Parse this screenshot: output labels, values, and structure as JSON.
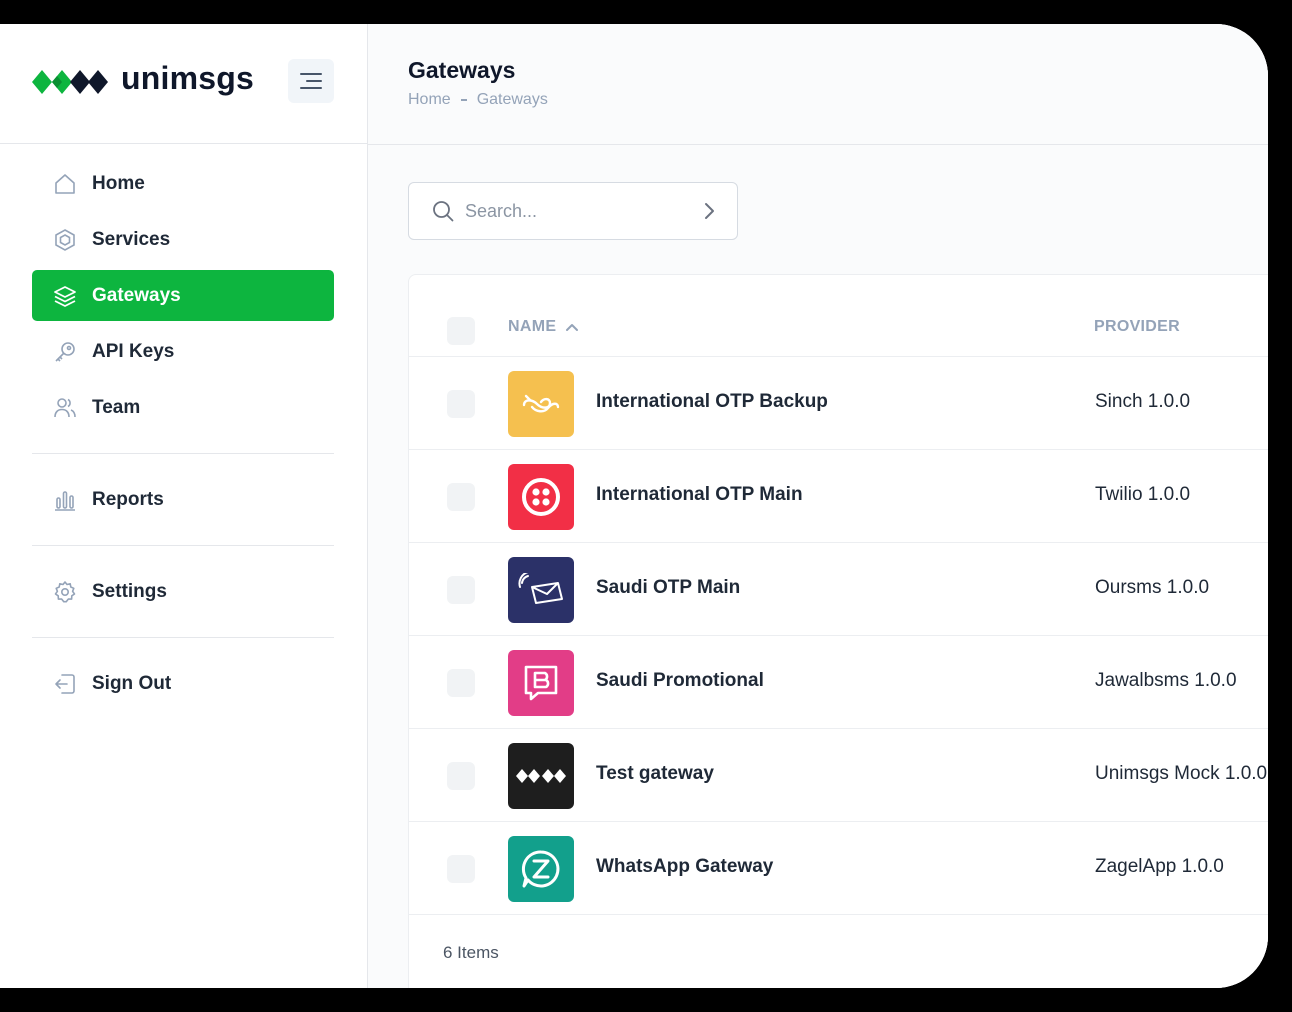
{
  "brand": {
    "name": "unimsgs"
  },
  "sidebar": {
    "items": [
      {
        "label": "Home",
        "icon": "home-icon",
        "active": false
      },
      {
        "label": "Services",
        "icon": "hexagon-icon",
        "active": false
      },
      {
        "label": "Gateways",
        "icon": "layers-icon",
        "active": true
      },
      {
        "label": "API Keys",
        "icon": "key-icon",
        "active": false
      },
      {
        "label": "Team",
        "icon": "users-icon",
        "active": false
      }
    ],
    "reports": {
      "label": "Reports",
      "icon": "bar-chart-icon"
    },
    "settings": {
      "label": "Settings",
      "icon": "gear-icon"
    },
    "signout": {
      "label": "Sign Out",
      "icon": "sign-out-icon"
    }
  },
  "header": {
    "title": "Gateways",
    "breadcrumb": [
      "Home",
      "Gateways"
    ]
  },
  "search": {
    "placeholder": "Search...",
    "value": ""
  },
  "table": {
    "columns": {
      "name": "NAME",
      "provider": "PROVIDER"
    },
    "rows": [
      {
        "name": "International OTP Backup",
        "provider": "Sinch 1.0.0",
        "logo": "sinch-logo",
        "color": "#f5c04f"
      },
      {
        "name": "International OTP Main",
        "provider": "Twilio 1.0.0",
        "logo": "twilio-logo",
        "color": "#f22f46"
      },
      {
        "name": "Saudi OTP Main",
        "provider": "Oursms 1.0.0",
        "logo": "oursms-logo",
        "color": "#2b3168"
      },
      {
        "name": "Saudi Promotional",
        "provider": "Jawalbsms 1.0.0",
        "logo": "jawalbsms-logo",
        "color": "#e23d87"
      },
      {
        "name": "Test gateway",
        "provider": "Unimsgs Mock 1.0.0",
        "logo": "unimsgs-logo",
        "color": "#1e1e1e"
      },
      {
        "name": "WhatsApp Gateway",
        "provider": "ZagelApp 1.0.0",
        "logo": "zagelapp-logo",
        "color": "#12a08c"
      }
    ],
    "count_label": "6 Items"
  },
  "colors": {
    "accent": "#0db53f",
    "brand_dark": "#0f172a"
  }
}
